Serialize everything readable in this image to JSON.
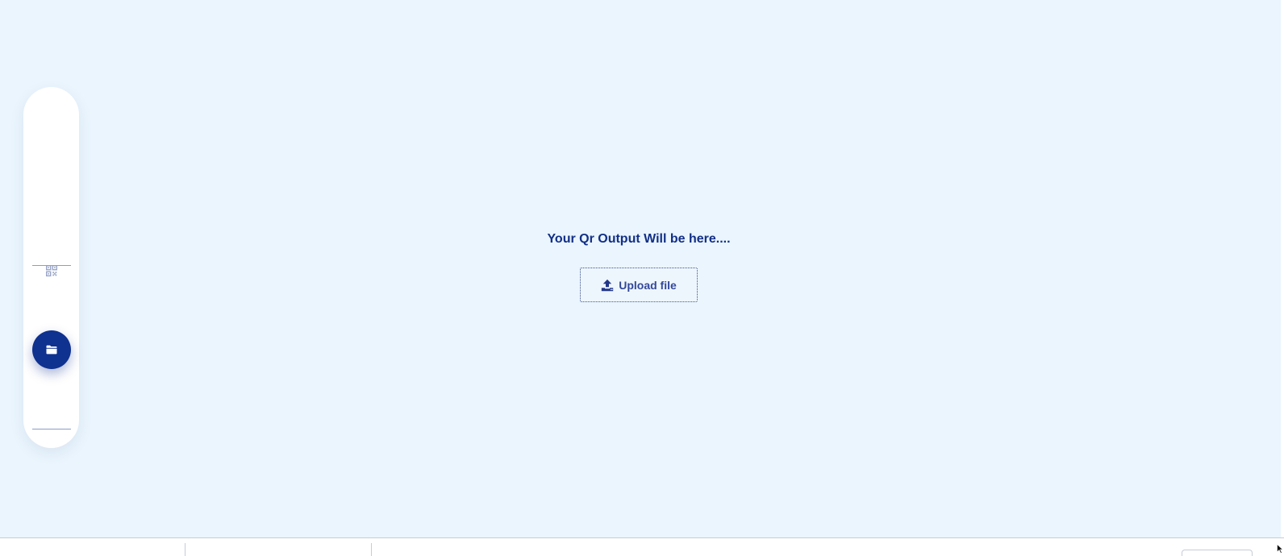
{
  "main": {
    "output_title": "Your Qr Output Will be here....",
    "upload_label": "Upload file"
  },
  "sidebar": {
    "items": [
      {
        "icon": "qr-code-icon",
        "active": false
      },
      {
        "icon": "folder-icon",
        "active": true
      }
    ]
  },
  "colors": {
    "background": "#eaf5fe",
    "primary": "#0f318f",
    "text": "#122f86",
    "button_text": "#33489a"
  }
}
